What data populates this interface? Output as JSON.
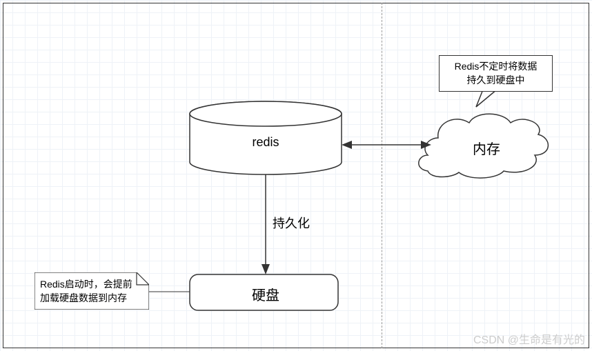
{
  "nodes": {
    "redis": "redis",
    "memory": "内存",
    "disk": "硬盘"
  },
  "edges": {
    "persist": "持久化"
  },
  "callout": {
    "line1": "Redis不定时将数据",
    "line2": "持久到硬盘中"
  },
  "note": {
    "line1": "Redis启动时，会提前",
    "line2": "加载硬盘数据到内存"
  },
  "watermark": "CSDN @生命是有光的"
}
